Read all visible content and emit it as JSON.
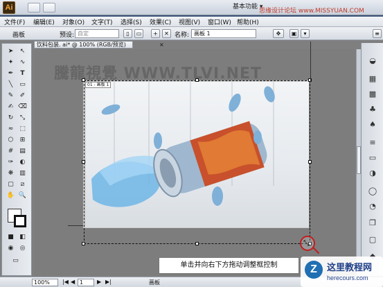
{
  "app": {
    "logo": "Ai",
    "workspace_label": "基本功能 ▾",
    "site_watermark": "思缘设计论坛 www.MISSYUAN.COM"
  },
  "menu": [
    "文件(F)",
    "编辑(E)",
    "对象(O)",
    "文字(T)",
    "选择(S)",
    "效果(C)",
    "视图(V)",
    "窗口(W)",
    "帮助(H)"
  ],
  "control_bar": {
    "mode_label": "画板",
    "preset_label": "预设:",
    "preset_value": "自定",
    "name_label": "名称:",
    "name_value": "画板 1"
  },
  "document": {
    "tab_title": "饮料包装. ai* @ 100% (RGB/预览)",
    "tab_close": "×",
    "artboard_label": "01 - 画板 1",
    "background_watermark": "騰龍視覺 WWW.TLVI.NET"
  },
  "tooltip": "单击并向右下方拖动调整框控制",
  "status_bar": {
    "zoom": "100%",
    "page": "1",
    "status": "画板"
  },
  "brand": {
    "logo_letter": "Z",
    "name": "这里教程网",
    "url": "herecours.com"
  },
  "colors": {
    "accent": "#c21d1d",
    "canvas": "#7d7d7d",
    "brand_blue": "#1f3f88"
  }
}
